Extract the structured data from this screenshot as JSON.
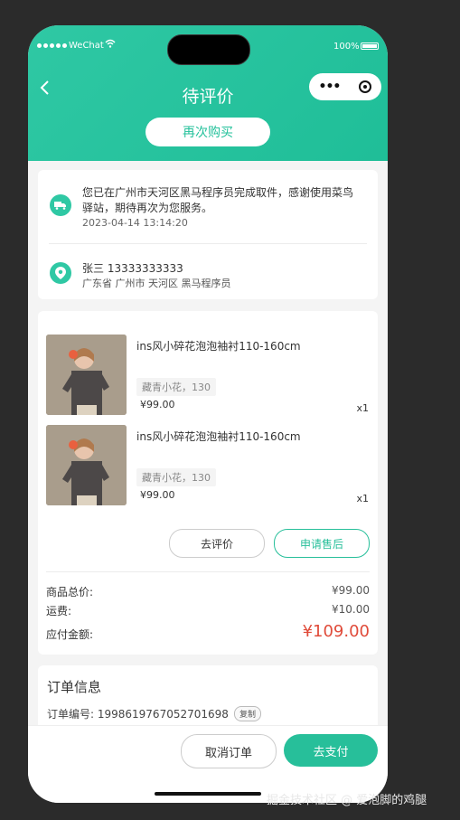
{
  "status_bar": {
    "carrier": "WeChat",
    "battery": "100%"
  },
  "header": {
    "title": "待评价",
    "rebuy_label": "再次购买"
  },
  "logistics": {
    "message": "您已在广州市天河区黑马程序员完成取件，感谢使用菜鸟驿站，期待再次为您服务。",
    "time": "2023-04-14 13:14:20"
  },
  "address": {
    "name_phone": "张三 13333333333",
    "detail": "广东省 广州市 天河区 黑马程序员"
  },
  "goods": [
    {
      "name": "ins风小碎花泡泡袖衬110-160cm",
      "spec": "藏青小花，130",
      "price": "¥99.00",
      "qty": "x1"
    },
    {
      "name": "ins风小碎花泡泡袖衬110-160cm",
      "spec": "藏青小花，130",
      "price": "¥99.00",
      "qty": "x1"
    }
  ],
  "actions": {
    "review": "去评价",
    "after_sale": "申请售后"
  },
  "summary": {
    "goods_total_label": "商品总价:",
    "goods_total": "¥99.00",
    "shipping_label": "运费:",
    "shipping": "¥10.00",
    "payable_label": "应付金额:",
    "payable": "¥109.00"
  },
  "order_info": {
    "title": "订单信息",
    "order_no": "订单编号: 19986197670527016­98",
    "copy": "复制"
  },
  "bottom": {
    "cancel": "取消订单",
    "pay": "去支付"
  },
  "watermark": "掘金技术社区 @ 爱泡脚的鸡腿",
  "colors": {
    "brand": "#27bf9a",
    "price_red": "#e04b3a"
  }
}
